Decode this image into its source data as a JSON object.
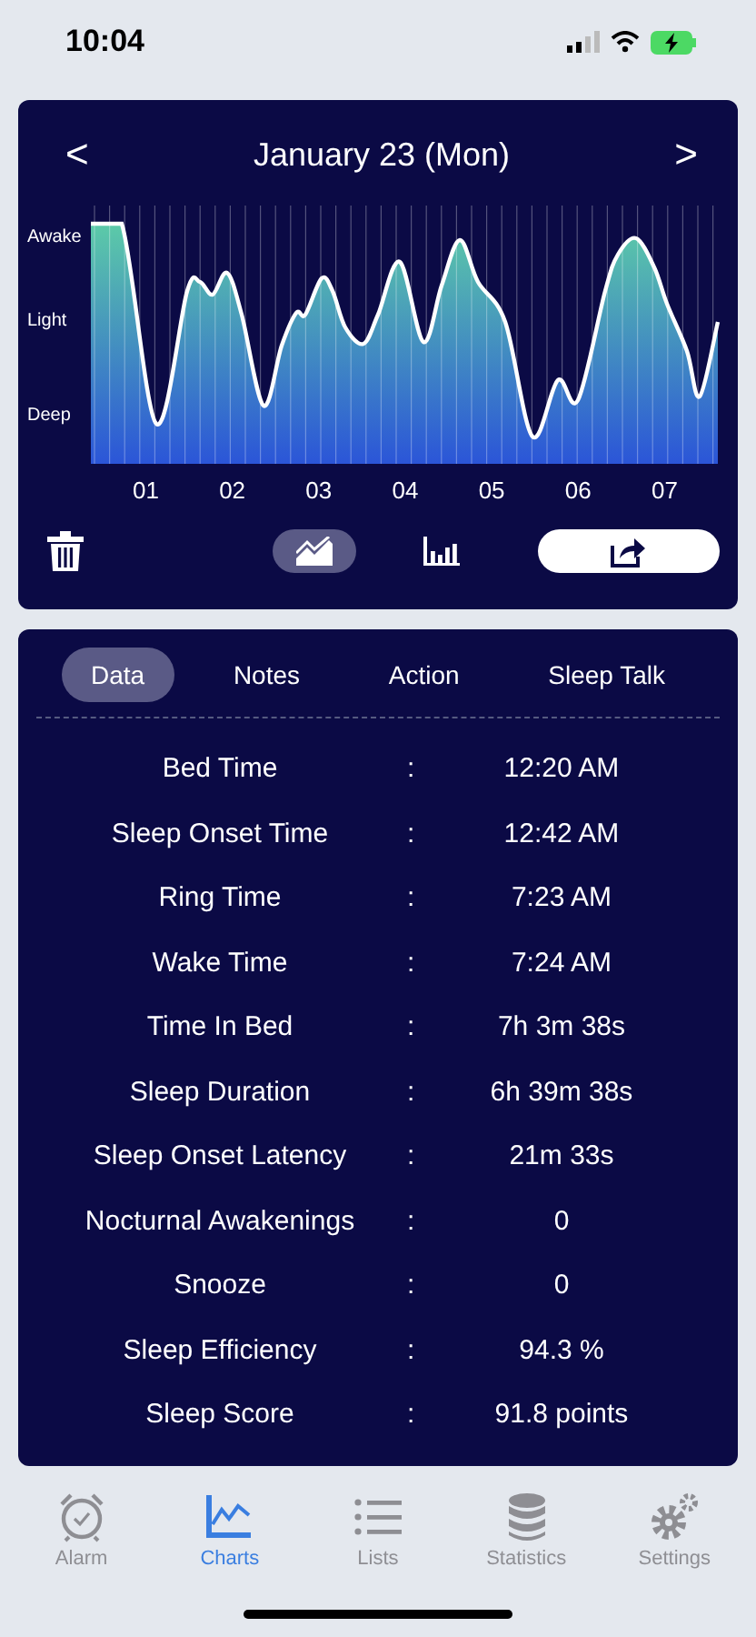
{
  "status_bar": {
    "time": "10:04"
  },
  "chart_card": {
    "date": "January 23 (Mon)",
    "prev": "<",
    "next": ">",
    "y_labels": [
      "Awake",
      "Light",
      "Deep"
    ],
    "x_labels": [
      "01",
      "02",
      "03",
      "04",
      "05",
      "06",
      "07"
    ],
    "view_modes": [
      {
        "kind": "line",
        "selected": true
      },
      {
        "kind": "bar",
        "selected": false
      }
    ]
  },
  "tabs": [
    {
      "label": "Data",
      "selected": true
    },
    {
      "label": "Notes",
      "selected": false
    },
    {
      "label": "Action",
      "selected": false
    },
    {
      "label": "Sleep Talk",
      "selected": false
    }
  ],
  "rows": [
    {
      "label": "Bed Time",
      "separator": ":",
      "value": "12:20 AM"
    },
    {
      "label": "Sleep Onset Time",
      "separator": ":",
      "value": "12:42 AM"
    },
    {
      "label": "Ring Time",
      "separator": ":",
      "value": "7:23 AM"
    },
    {
      "label": "Wake Time",
      "separator": ":",
      "value": "7:24 AM"
    },
    {
      "label": "Time In Bed",
      "separator": ":",
      "value": "7h 3m 38s"
    },
    {
      "label": "Sleep Duration",
      "separator": ":",
      "value": "6h 39m 38s"
    },
    {
      "label": "Sleep Onset Latency",
      "separator": ":",
      "value": "21m 33s"
    },
    {
      "label": "Nocturnal Awakenings",
      "separator": ":",
      "value": "0"
    },
    {
      "label": "Snooze",
      "separator": ":",
      "value": "0"
    },
    {
      "label": "Sleep Efficiency",
      "separator": ":",
      "value": "94.3 %"
    },
    {
      "label": "Sleep Score",
      "separator": ":",
      "value": "91.8 points"
    }
  ],
  "tab_bar": [
    {
      "kind": "alarm",
      "label": "Alarm",
      "selected": false
    },
    {
      "kind": "charts",
      "label": "Charts",
      "selected": true
    },
    {
      "kind": "lists",
      "label": "Lists",
      "selected": false
    },
    {
      "kind": "statistics",
      "label": "Statistics",
      "selected": false
    },
    {
      "kind": "settings",
      "label": "Settings",
      "selected": false
    }
  ]
}
